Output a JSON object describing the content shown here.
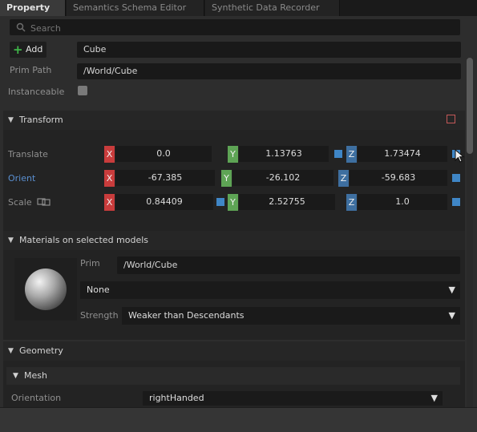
{
  "tabs": [
    "Property",
    "Semantics Schema Editor",
    "Synthetic Data Recorder"
  ],
  "search": {
    "placeholder": "Search"
  },
  "add_button": {
    "label": "Add"
  },
  "prim_name": "Cube",
  "prim_path": {
    "label": "Prim Path",
    "value": "/World/Cube"
  },
  "instanceable": {
    "label": "Instanceable",
    "checked": false
  },
  "transform": {
    "title": "Transform",
    "rows": [
      {
        "label": "Translate",
        "x": "0.0",
        "y": "1.13763",
        "z": "1.73474"
      },
      {
        "label": "Orient",
        "x": "-67.385",
        "y": "-26.102",
        "z": "-59.683"
      },
      {
        "label": "Scale",
        "x": "0.84409",
        "y": "2.52755",
        "z": "1.0"
      }
    ],
    "axis_labels": {
      "x": "X",
      "y": "Y",
      "z": "Z"
    }
  },
  "materials": {
    "title": "Materials on selected models",
    "prim_label": "Prim",
    "prim_value": "/World/Cube",
    "material_value": "None",
    "strength_label": "Strength",
    "strength_value": "Weaker than Descendants"
  },
  "geometry": {
    "title": "Geometry",
    "mesh_title": "Mesh",
    "orientation_label": "Orientation",
    "orientation_value": "rightHanded"
  },
  "colors": {
    "x_axis": "#c93c3c",
    "y_axis": "#5ea455",
    "z_axis": "#3e6fa0",
    "accent_square": "#3f86c6",
    "add_icon": "#3fb649"
  }
}
